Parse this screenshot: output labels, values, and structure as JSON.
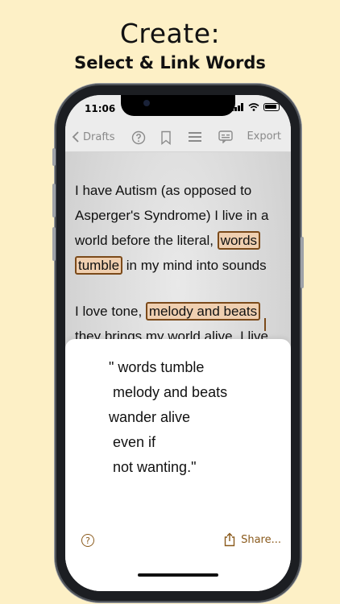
{
  "headline": {
    "title": "Create:",
    "subtitle": "Select & Link Words"
  },
  "status_bar": {
    "time": "11:06"
  },
  "toolbar": {
    "back_label": "Drafts",
    "export_label": "Export"
  },
  "reader": {
    "paragraph1": {
      "before": "I have Autism (as opposed to Asperger's Syndrome) I live in a world before the literal, ",
      "highlight1": "words",
      "middle": " ",
      "highlight2": "tumble",
      "after": " in my mind into sounds"
    },
    "paragraph2": {
      "before": "I love tone, ",
      "highlight": "melody and beats",
      "after": " they brings my world alive. I live"
    }
  },
  "sheet": {
    "poem_lines": [
      "\" words tumble",
      " melody and beats",
      "wander alive",
      " even if",
      " not wanting.\""
    ],
    "help_symbol": "?",
    "share_label": "Share..."
  },
  "colors": {
    "background": "#fdf0c6",
    "accent": "#8a5a1c",
    "highlight_fill": "#efcfb0",
    "highlight_border": "#7b4a1a"
  },
  "icons": {
    "toolbar": [
      "chevron-left-icon",
      "help-circle-icon",
      "bookmark-icon",
      "text-align-icon",
      "caption-icon"
    ],
    "status": [
      "signal-icon",
      "wifi-icon",
      "battery-icon"
    ],
    "sheet": [
      "help-circle-icon",
      "share-icon"
    ]
  }
}
